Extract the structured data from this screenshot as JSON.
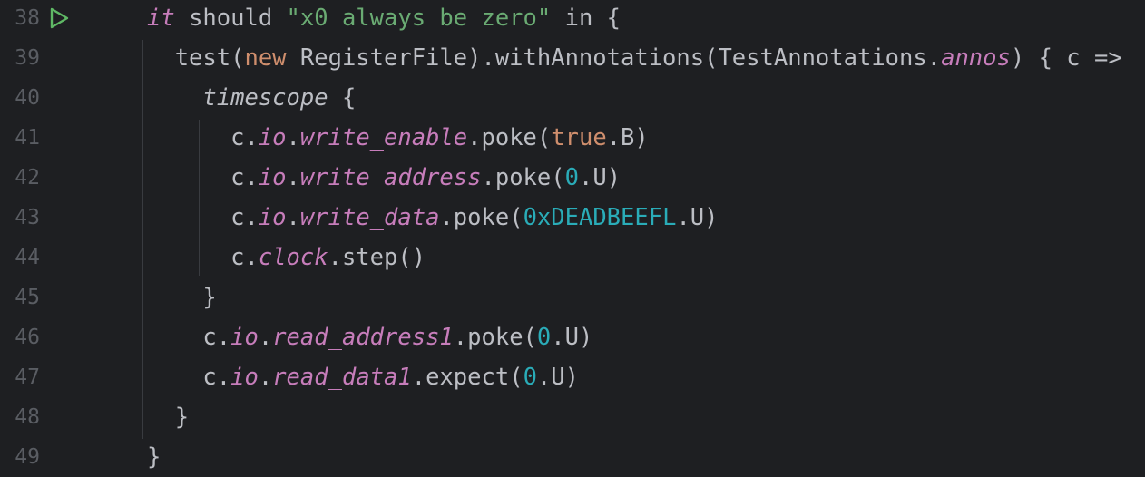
{
  "editor": {
    "lines": [
      {
        "number": "38",
        "has_run_icon": true,
        "tokens": [
          {
            "t": "it",
            "c": "kw-it"
          },
          {
            "t": " should ",
            "c": ""
          },
          {
            "t": "\"x0 always be zero\"",
            "c": "str"
          },
          {
            "t": " in {",
            "c": ""
          }
        ]
      },
      {
        "number": "39",
        "tokens": [
          {
            "t": "  test(",
            "c": ""
          },
          {
            "t": "new",
            "c": "kw"
          },
          {
            "t": " RegisterFile).withAnnotations(TestAnnotations.",
            "c": ""
          },
          {
            "t": "annos",
            "c": "field"
          },
          {
            "t": ") { c =>",
            "c": ""
          }
        ]
      },
      {
        "number": "40",
        "tokens": [
          {
            "t": "    ",
            "c": ""
          },
          {
            "t": "timescope",
            "c": "italic"
          },
          {
            "t": " {",
            "c": ""
          }
        ]
      },
      {
        "number": "41",
        "tokens": [
          {
            "t": "      c.",
            "c": ""
          },
          {
            "t": "io",
            "c": "field"
          },
          {
            "t": ".",
            "c": ""
          },
          {
            "t": "write_enable",
            "c": "field"
          },
          {
            "t": ".poke(",
            "c": ""
          },
          {
            "t": "true",
            "c": "kw"
          },
          {
            "t": ".B)",
            "c": ""
          }
        ]
      },
      {
        "number": "42",
        "tokens": [
          {
            "t": "      c.",
            "c": ""
          },
          {
            "t": "io",
            "c": "field"
          },
          {
            "t": ".",
            "c": ""
          },
          {
            "t": "write_address",
            "c": "field"
          },
          {
            "t": ".poke(",
            "c": ""
          },
          {
            "t": "0",
            "c": "num"
          },
          {
            "t": ".U)",
            "c": ""
          }
        ]
      },
      {
        "number": "43",
        "tokens": [
          {
            "t": "      c.",
            "c": ""
          },
          {
            "t": "io",
            "c": "field"
          },
          {
            "t": ".",
            "c": ""
          },
          {
            "t": "write_data",
            "c": "field"
          },
          {
            "t": ".poke(",
            "c": ""
          },
          {
            "t": "0xDEADBEEFL",
            "c": "num"
          },
          {
            "t": ".U)",
            "c": ""
          }
        ]
      },
      {
        "number": "44",
        "tokens": [
          {
            "t": "      c.",
            "c": ""
          },
          {
            "t": "clock",
            "c": "field"
          },
          {
            "t": ".step()",
            "c": ""
          }
        ]
      },
      {
        "number": "45",
        "tokens": [
          {
            "t": "    }",
            "c": ""
          }
        ]
      },
      {
        "number": "46",
        "tokens": [
          {
            "t": "    c.",
            "c": ""
          },
          {
            "t": "io",
            "c": "field"
          },
          {
            "t": ".",
            "c": ""
          },
          {
            "t": "read_address1",
            "c": "field"
          },
          {
            "t": ".poke(",
            "c": ""
          },
          {
            "t": "0",
            "c": "num"
          },
          {
            "t": ".U)",
            "c": ""
          }
        ]
      },
      {
        "number": "47",
        "tokens": [
          {
            "t": "    c.",
            "c": ""
          },
          {
            "t": "io",
            "c": "field"
          },
          {
            "t": ".",
            "c": ""
          },
          {
            "t": "read_data1",
            "c": "field"
          },
          {
            "t": ".expect(",
            "c": ""
          },
          {
            "t": "0",
            "c": "num"
          },
          {
            "t": ".U)",
            "c": ""
          }
        ]
      },
      {
        "number": "48",
        "tokens": [
          {
            "t": "  }",
            "c": ""
          }
        ]
      },
      {
        "number": "49",
        "tokens": [
          {
            "t": "}",
            "c": ""
          }
        ]
      }
    ]
  },
  "colors": {
    "background": "#1e1f22",
    "text": "#bcbec4",
    "keyword": "#cf8e6d",
    "string": "#6aab73",
    "number": "#2aacb8",
    "field": "#c77dbb",
    "line_number": "#5a5d63",
    "run_icon": "#5fb865"
  },
  "icons": {
    "run": "run-test-icon"
  }
}
